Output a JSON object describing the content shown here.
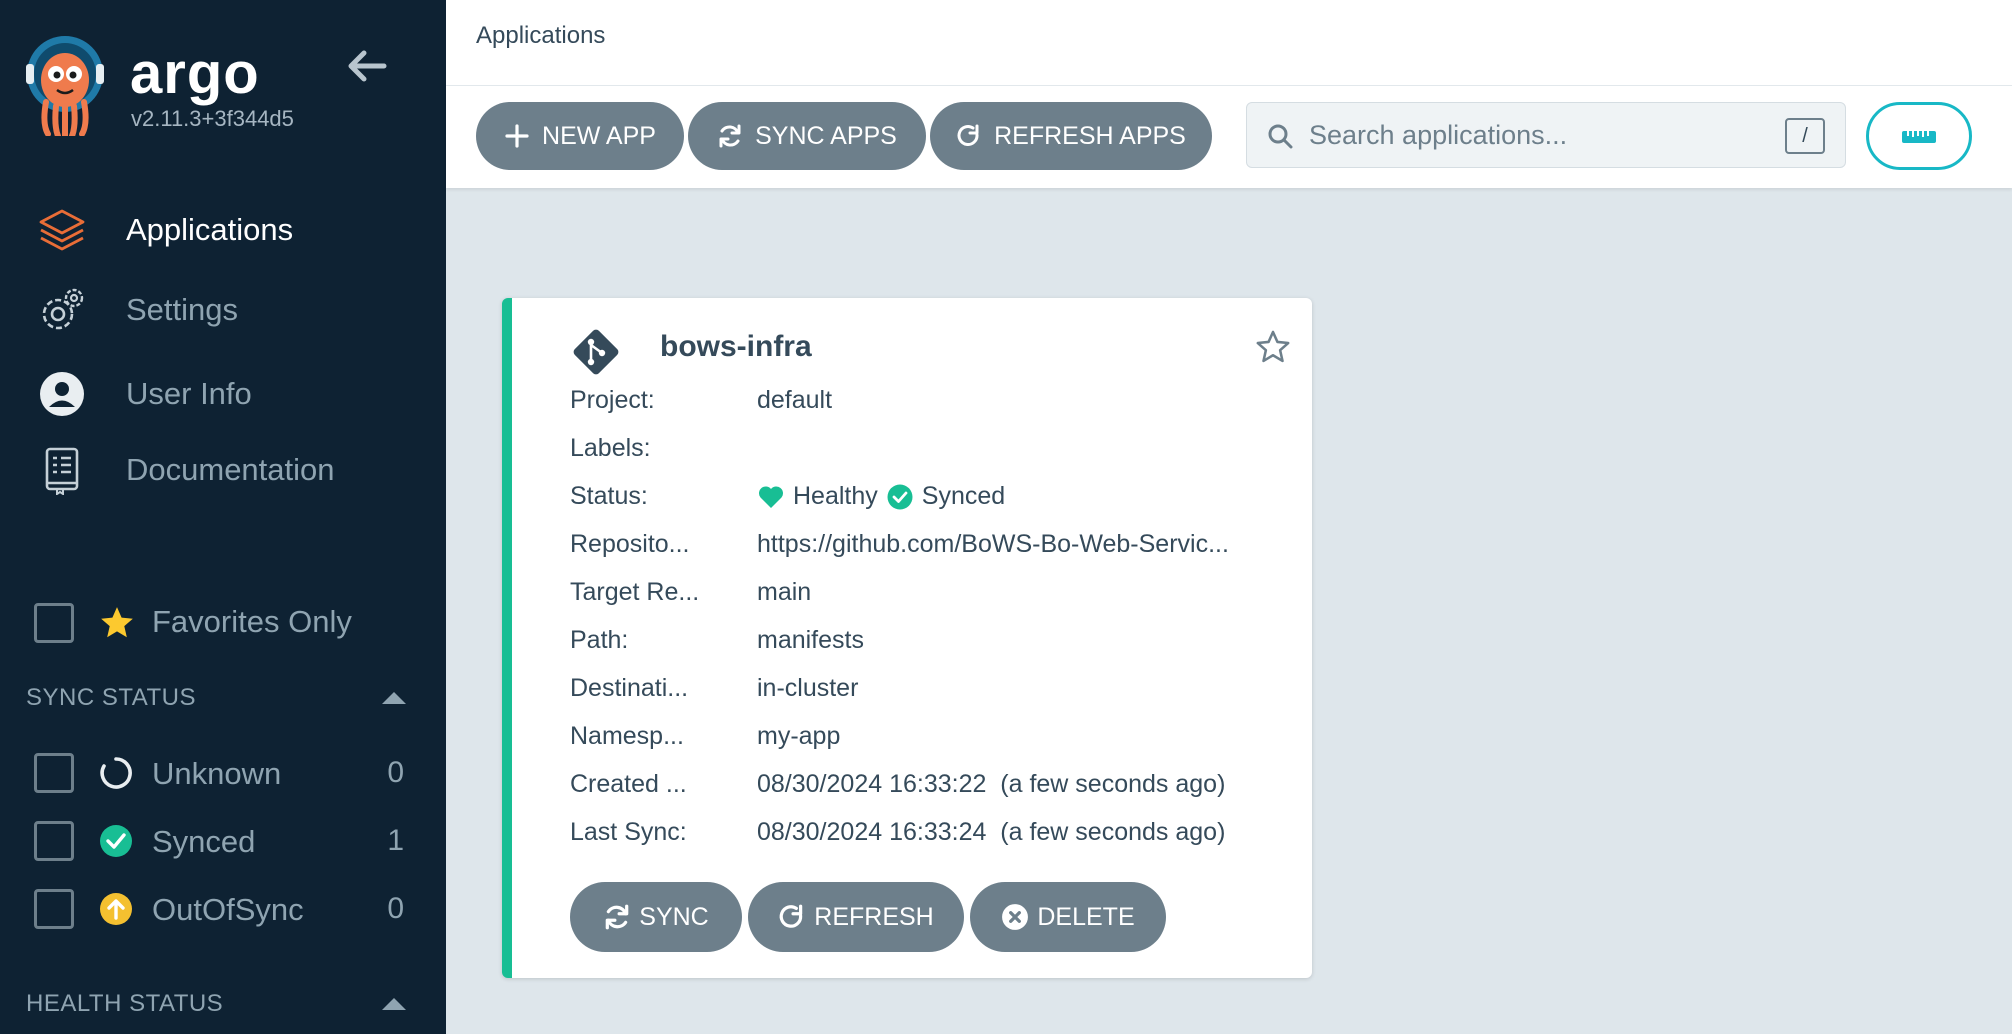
{
  "sidebar": {
    "brand": "argo",
    "version": "v2.11.3+3f344d5",
    "nav": [
      {
        "label": "Applications",
        "icon": "layers-icon",
        "active": true
      },
      {
        "label": "Settings",
        "icon": "gears-icon",
        "active": false
      },
      {
        "label": "User Info",
        "icon": "user-circle-icon",
        "active": false
      },
      {
        "label": "Documentation",
        "icon": "book-icon",
        "active": false
      }
    ],
    "favorites_label": "Favorites Only",
    "sync_status": {
      "header": "SYNC STATUS",
      "items": [
        {
          "label": "Unknown",
          "count": "0",
          "icon": "circle-notch-icon"
        },
        {
          "label": "Synced",
          "count": "1",
          "icon": "check-circle-icon"
        },
        {
          "label": "OutOfSync",
          "count": "0",
          "icon": "arrow-up-circle-icon"
        }
      ]
    },
    "health_status": {
      "header": "HEALTH STATUS"
    }
  },
  "header": {
    "title": "Applications"
  },
  "toolbar": {
    "new_app": "NEW APP",
    "sync_apps": "SYNC APPS",
    "refresh_apps": "REFRESH APPS",
    "search_placeholder": "Search applications...",
    "search_shortcut": "/"
  },
  "app": {
    "name": "bows-infra",
    "fields": [
      {
        "key": "Project:",
        "value": "default"
      },
      {
        "key": "Labels:",
        "value": ""
      },
      {
        "key": "Status:",
        "value": ""
      },
      {
        "key": "Reposito...",
        "value": "https://github.com/BoWS-Bo-Web-Servic..."
      },
      {
        "key": "Target Re...",
        "value": "main"
      },
      {
        "key": "Path:",
        "value": "manifests"
      },
      {
        "key": "Destinati...",
        "value": "in-cluster"
      },
      {
        "key": "Namesp...",
        "value": "my-app"
      },
      {
        "key": "Created ...",
        "value": "08/30/2024 16:33:22  (a few seconds ago)"
      },
      {
        "key": "Last Sync:",
        "value": "08/30/2024 16:33:24  (a few seconds ago)"
      }
    ],
    "health": "Healthy",
    "sync": "Synced",
    "buttons": {
      "sync": "SYNC",
      "refresh": "REFRESH",
      "delete": "DELETE"
    }
  },
  "colors": {
    "sidebar_bg": "#0e2233",
    "accent_orange": "#e96d37",
    "status_green": "#18be94",
    "out_of_sync_yellow": "#f4c030",
    "favorite_yellow": "#fcc92f",
    "teal": "#18b8c6",
    "button_gray": "#6d7f8b"
  }
}
